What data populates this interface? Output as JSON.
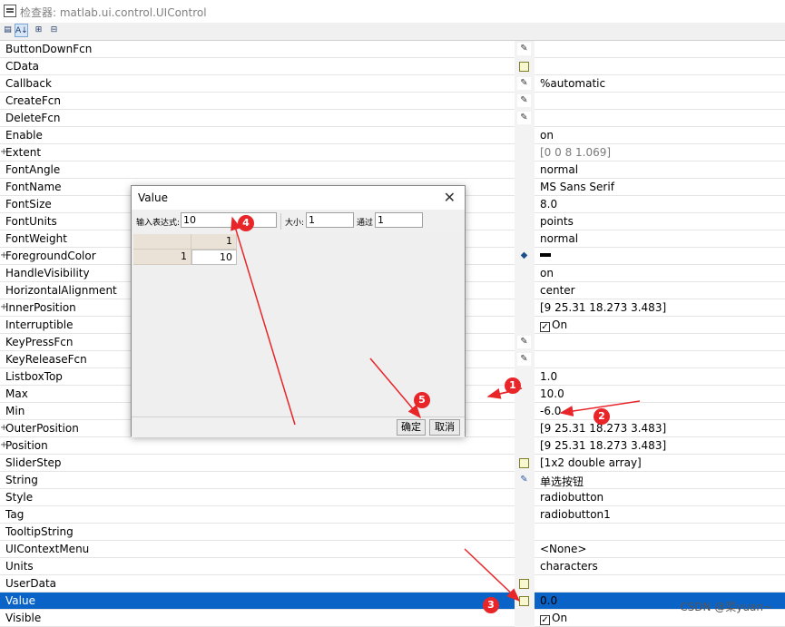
{
  "window": {
    "title": "检查器: matlab.ui.control.UIControl"
  },
  "toolbar": {
    "buttons": [
      "categorized-icon",
      "alphabetical-icon",
      "expand-all-icon",
      "collapse-all-icon"
    ]
  },
  "properties": [
    {
      "name": "ButtonDownFcn",
      "icon": "callback",
      "value": ""
    },
    {
      "name": "CData",
      "icon": "table",
      "value": ""
    },
    {
      "name": "Callback",
      "icon": "callback",
      "value": "%automatic"
    },
    {
      "name": "CreateFcn",
      "icon": "callback",
      "value": ""
    },
    {
      "name": "DeleteFcn",
      "icon": "callback",
      "value": ""
    },
    {
      "name": "Enable",
      "icon": "",
      "value": "on"
    },
    {
      "name": "Extent",
      "icon": "",
      "value": "[0 0 8 1.069]",
      "expand": true,
      "gray": true
    },
    {
      "name": "FontAngle",
      "icon": "",
      "value": "normal"
    },
    {
      "name": "FontName",
      "icon": "",
      "value": "MS Sans Serif"
    },
    {
      "name": "FontSize",
      "icon": "",
      "value": "8.0"
    },
    {
      "name": "FontUnits",
      "icon": "",
      "value": "points"
    },
    {
      "name": "FontWeight",
      "icon": "",
      "value": "normal"
    },
    {
      "name": "ForegroundColor",
      "icon": "color",
      "value": "",
      "expand": true,
      "swatch": true
    },
    {
      "name": "HandleVisibility",
      "icon": "",
      "value": "on"
    },
    {
      "name": "HorizontalAlignment",
      "icon": "",
      "value": "center"
    },
    {
      "name": "InnerPosition",
      "icon": "",
      "value": "[9 25.31 18.273 3.483]",
      "expand": true
    },
    {
      "name": "Interruptible",
      "icon": "",
      "value": "On",
      "check": true
    },
    {
      "name": "KeyPressFcn",
      "icon": "callback",
      "value": ""
    },
    {
      "name": "KeyReleaseFcn",
      "icon": "callback",
      "value": ""
    },
    {
      "name": "ListboxTop",
      "icon": "",
      "value": "1.0"
    },
    {
      "name": "Max",
      "icon": "",
      "value": "10.0"
    },
    {
      "name": "Min",
      "icon": "",
      "value": "-6.0"
    },
    {
      "name": "OuterPosition",
      "icon": "",
      "value": "[9 25.31 18.273 3.483]",
      "expand": true
    },
    {
      "name": "Position",
      "icon": "",
      "value": "[9 25.31 18.273 3.483]",
      "expand": true
    },
    {
      "name": "SliderStep",
      "icon": "table",
      "value": "[1x2  double array]"
    },
    {
      "name": "String",
      "icon": "edit",
      "value": "单选按钮"
    },
    {
      "name": "Style",
      "icon": "",
      "value": "radiobutton"
    },
    {
      "name": "Tag",
      "icon": "",
      "value": "radiobutton1"
    },
    {
      "name": "TooltipString",
      "icon": "",
      "value": ""
    },
    {
      "name": "UIContextMenu",
      "icon": "",
      "value": "<None>"
    },
    {
      "name": "Units",
      "icon": "",
      "value": "characters"
    },
    {
      "name": "UserData",
      "icon": "table",
      "value": ""
    },
    {
      "name": "Value",
      "icon": "table",
      "value": "0.0",
      "selected": true
    },
    {
      "name": "Visible",
      "icon": "",
      "value": "On",
      "check": true
    }
  ],
  "dialog": {
    "title": "Value",
    "close_glyph": "✕",
    "expr_label": "输入表达式:",
    "expr_value": "10",
    "size_label": "大小:",
    "size_value": "1",
    "by_label": "通过",
    "by_value": "1",
    "col_header": "1",
    "row_header": "1",
    "cell_value": "10",
    "ok_label": "确定",
    "cancel_label": "取消"
  },
  "annotations": {
    "badges": [
      "1",
      "2",
      "3",
      "4",
      "5"
    ],
    "color": "#e8262a"
  },
  "watermark": "CSDN @菜yuan~"
}
